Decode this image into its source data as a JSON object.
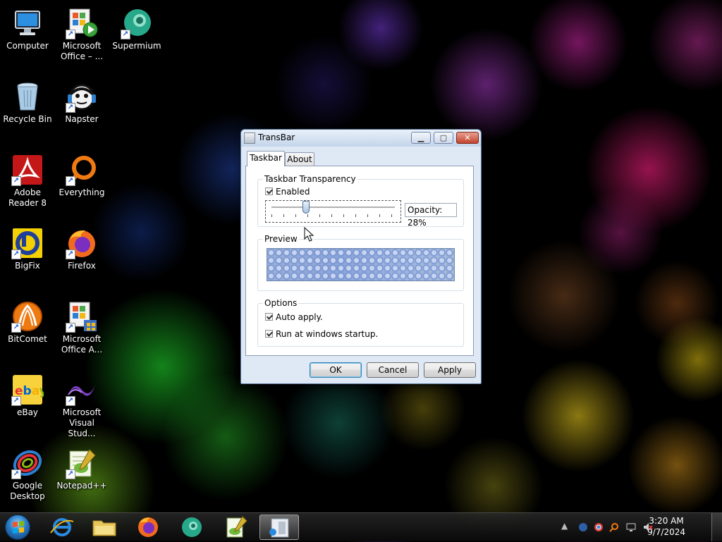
{
  "desktop": {
    "icons": [
      {
        "label": "Computer"
      },
      {
        "label": "Microsoft Office – ..."
      },
      {
        "label": "Supermium"
      },
      {
        "label": "Recycle Bin"
      },
      {
        "label": "Napster"
      },
      {
        "label": "Adobe Reader 8"
      },
      {
        "label": "Everything"
      },
      {
        "label": "BigFix"
      },
      {
        "label": "Firefox"
      },
      {
        "label": "BitComet"
      },
      {
        "label": "Microsoft Office A..."
      },
      {
        "label": "eBay"
      },
      {
        "label": "Microsoft Visual Stud..."
      },
      {
        "label": "Google Desktop"
      },
      {
        "label": "Notepad++"
      }
    ]
  },
  "dialog": {
    "title": "TransBar",
    "minimize_glyph": "▁",
    "maximize_glyph": "▢",
    "close_glyph": "✕",
    "tabs": [
      {
        "label": "Taskbar"
      },
      {
        "label": "About"
      }
    ],
    "transparency": {
      "group_title": "Taskbar Transparency",
      "enabled_label": "Enabled",
      "enabled_checked": true,
      "opacity_text": "Opacity: 28%",
      "opacity_value": 28
    },
    "preview": {
      "group_title": "Preview"
    },
    "options": {
      "group_title": "Options",
      "auto_apply_label": "Auto apply.",
      "auto_apply_checked": true,
      "startup_label": "Run at windows startup.",
      "startup_checked": true
    },
    "buttons": {
      "ok": "OK",
      "cancel": "Cancel",
      "apply": "Apply"
    }
  },
  "taskbar": {
    "clock_time": "3:20 AM",
    "clock_date": "9/7/2024",
    "pinned": [
      "internet-explorer",
      "windows-explorer",
      "firefox",
      "supermium",
      "notepad-plus-plus",
      "transbar"
    ],
    "active": "transbar"
  },
  "colors": {
    "accent": "#3c7fb1",
    "dialog_bg": "#dfe9f5"
  }
}
